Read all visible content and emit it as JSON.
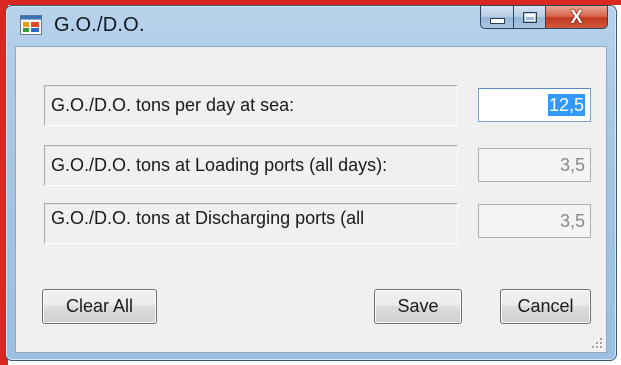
{
  "window": {
    "title": "G.O./D.O.",
    "controls": {
      "minimize_icon": "minimize-icon",
      "maximize_icon": "maximize-icon",
      "close_glyph": "X"
    }
  },
  "fields": [
    {
      "label": "G.O./D.O. tons per day at sea:",
      "value": "12,5",
      "enabled": true,
      "selected": true
    },
    {
      "label": "G.O./D.O. tons at Loading ports (all days):",
      "value": "3,5",
      "enabled": false,
      "selected": false
    },
    {
      "label": "G.O./D.O. tons at Discharging ports (all",
      "value": "3,5",
      "enabled": false,
      "selected": false
    }
  ],
  "buttons": {
    "clear_all": "Clear All",
    "save": "Save",
    "cancel": "Cancel"
  },
  "colors": {
    "titlebar": "#a6c6e3",
    "close_button": "#c1381e",
    "selection": "#3399ff",
    "client_bg": "#f0f0f0"
  }
}
